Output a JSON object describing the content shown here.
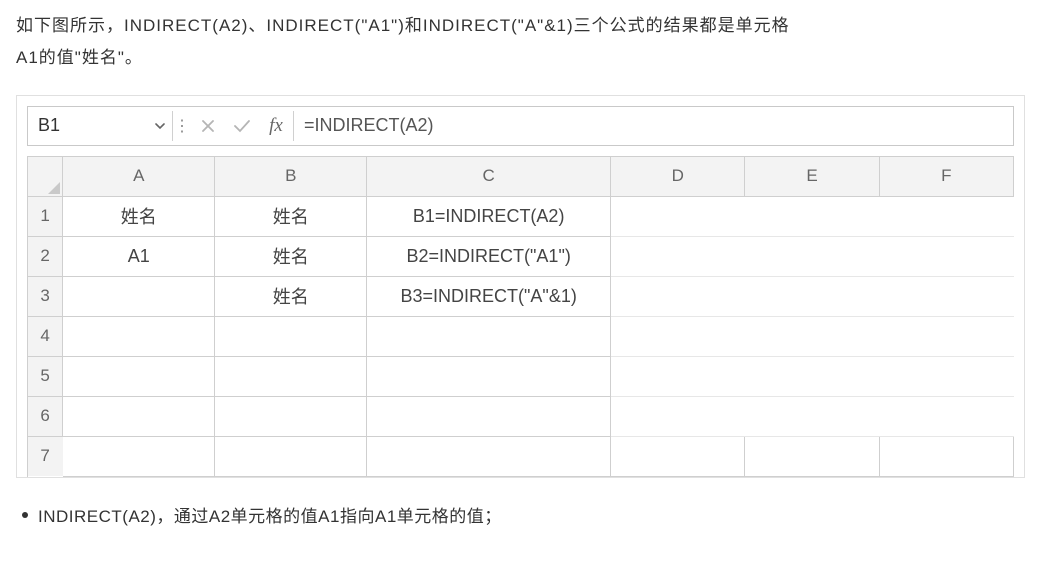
{
  "intro": {
    "line1": "如下图所示，INDIRECT(A2)、INDIRECT(\"A1\")和INDIRECT(\"A\"&1)三个公式的结果都是单元格",
    "line2": "A1的值\"姓名\"。"
  },
  "formula_bar": {
    "cell_ref": "B1",
    "fx_label": "fx",
    "formula": "=INDIRECT(A2)"
  },
  "columns": [
    "A",
    "B",
    "C",
    "D",
    "E",
    "F"
  ],
  "row_headers": [
    "1",
    "2",
    "3",
    "4",
    "5",
    "6",
    "7"
  ],
  "cells": {
    "r1": {
      "A": "姓名",
      "B": "姓名",
      "C": "B1=INDIRECT(A2)"
    },
    "r2": {
      "A": "A1",
      "B": "姓名",
      "C": "B2=INDIRECT(\"A1\")"
    },
    "r3": {
      "A": "",
      "B": "姓名",
      "C": "B3=INDIRECT(\"A\"&1)"
    },
    "r4": {
      "A": "",
      "B": "",
      "C": ""
    },
    "r5": {
      "A": "",
      "B": "",
      "C": ""
    },
    "r6": {
      "A": "",
      "B": "",
      "C": ""
    },
    "r7": {
      "A": "",
      "B": "",
      "C": ""
    }
  },
  "bullet": "INDIRECT(A2)，通过A2单元格的值A1指向A1单元格的值；"
}
